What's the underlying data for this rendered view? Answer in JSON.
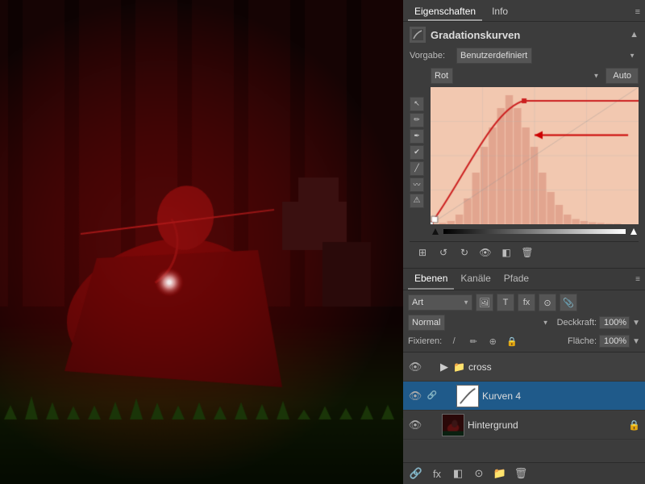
{
  "tabs": {
    "eigenschaften": "Eigenschaften",
    "info": "Info"
  },
  "curves_panel": {
    "title": "Gradationskurven",
    "vorgabe_label": "Vorgabe:",
    "vorgabe_value": "Benutzerdefiniert",
    "channel_value": "Rot",
    "auto_button": "Auto",
    "tools": [
      {
        "name": "pointer-tool",
        "icon": "↖",
        "active": false
      },
      {
        "name": "eyedropper-tool",
        "icon": "✏",
        "active": false
      },
      {
        "name": "eyedropper2-tool",
        "icon": "✒",
        "active": false
      },
      {
        "name": "eyedropper3-tool",
        "icon": "✔",
        "active": false
      },
      {
        "name": "pencil-tool",
        "icon": "╱",
        "active": false
      },
      {
        "name": "smooth-tool",
        "icon": "~",
        "active": false
      },
      {
        "name": "warning-tool",
        "icon": "⚠",
        "active": false
      }
    ],
    "toolbar_icons": [
      "⊞",
      "↺",
      "↻",
      "👁",
      "⊠",
      "🗑"
    ]
  },
  "layers_panel": {
    "tabs": [
      {
        "label": "Ebenen",
        "active": true
      },
      {
        "label": "Kanäle",
        "active": false
      },
      {
        "label": "Pfade",
        "active": false
      }
    ],
    "filter_label": "Art",
    "filter_icons": [
      "🖼",
      "T",
      "fx",
      "⊙",
      "📎"
    ],
    "blend_mode": "Normal",
    "opacity_label": "Deckkraft:",
    "opacity_value": "100%",
    "fixieren_label": "Fixieren:",
    "fix_icons": [
      "/",
      "✏",
      "⊕",
      "🔒"
    ],
    "flaeche_label": "Fläche:",
    "flaeche_value": "100%",
    "layers": [
      {
        "name": "cross",
        "type": "group",
        "visible": true,
        "locked": false,
        "selected": false,
        "indent": 0,
        "thumb_type": "folder"
      },
      {
        "name": "Kurven 4",
        "type": "adjustment",
        "visible": true,
        "locked": false,
        "selected": true,
        "indent": 1,
        "thumb_type": "white"
      },
      {
        "name": "Hintergrund",
        "type": "normal",
        "visible": true,
        "locked": true,
        "selected": false,
        "indent": 0,
        "thumb_type": "image"
      }
    ],
    "bottom_tools": [
      "fx",
      "⊙",
      "◧",
      "📁",
      "🗑"
    ]
  },
  "colors": {
    "selected_layer_bg": "#1f5a8a",
    "panel_bg": "#3c3c3c",
    "graph_bg": "#f5d0c0",
    "curve_color": "#cc0000",
    "arrow_color": "#cc0000"
  }
}
